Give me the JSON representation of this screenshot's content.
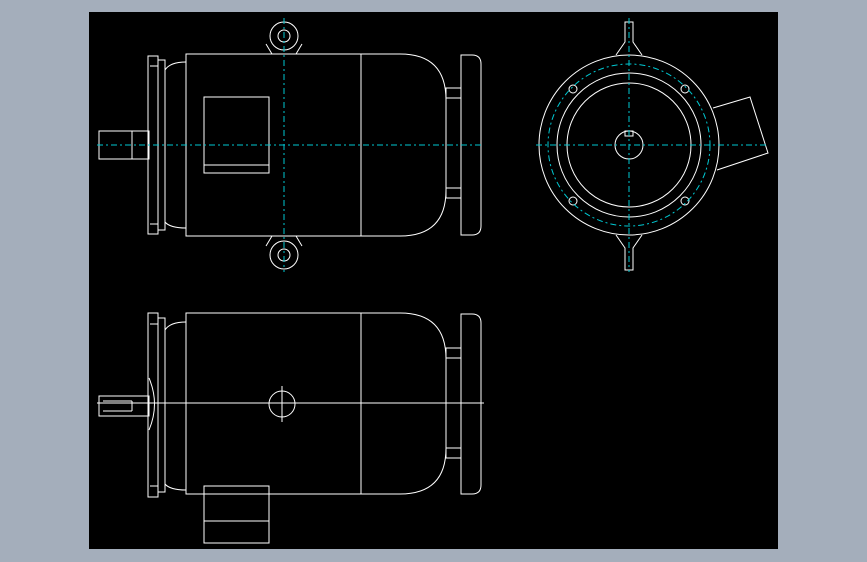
{
  "viewport": {
    "background_color": "#a4aebb",
    "canvas_color": "#000000"
  },
  "drawing": {
    "line_color": "#ffffff",
    "centerline_color": "#00c8d2",
    "views": [
      "side-view-top",
      "end-view",
      "side-view-bottom"
    ]
  }
}
